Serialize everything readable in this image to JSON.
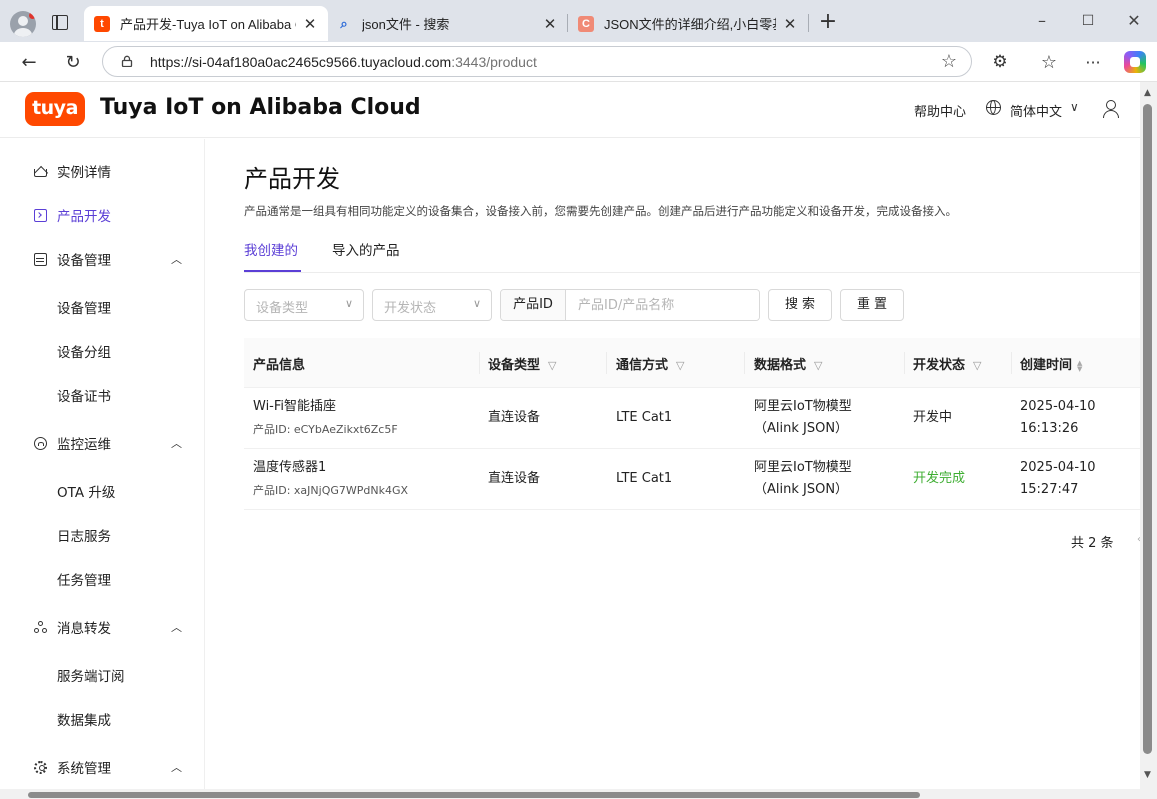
{
  "browser": {
    "tabs": [
      {
        "title": "产品开发-Tuya IoT on Alibaba Cloud",
        "favicon": "t",
        "favicon_color": "#ff4800",
        "active": true
      },
      {
        "title": "json文件 - 搜索",
        "favicon": "search-icon",
        "active": false
      },
      {
        "title": "JSON文件的详细介绍,小白零基础",
        "favicon": "C",
        "favicon_color": "#f08a76",
        "active": false
      }
    ],
    "url_main": "https://si-04af180a0ac2465c9566.tuyacloud.com",
    "url_rest": ":3443/product"
  },
  "app": {
    "logo_text": "tuya",
    "brand": "Tuya IoT on Alibaba Cloud",
    "help": "帮助中心",
    "language": "简体中文",
    "accent_color": "#5b3fd6"
  },
  "sidebar": {
    "items": [
      {
        "label": "实例详情",
        "icon": "home-icon"
      },
      {
        "label": "产品开发",
        "icon": "product-icon",
        "active": true
      },
      {
        "label": "设备管理",
        "icon": "device-icon",
        "expanded": true
      },
      {
        "label": "设备管理"
      },
      {
        "label": "设备分组"
      },
      {
        "label": "设备证书"
      },
      {
        "label": "监控运维",
        "icon": "monitor-icon",
        "expanded": true
      },
      {
        "label": "OTA 升级"
      },
      {
        "label": "日志服务"
      },
      {
        "label": "任务管理"
      },
      {
        "label": "消息转发",
        "icon": "message-icon",
        "expanded": true
      },
      {
        "label": "服务端订阅"
      },
      {
        "label": "数据集成"
      },
      {
        "label": "系统管理",
        "icon": "settings-icon",
        "expanded": true
      }
    ]
  },
  "page": {
    "title": "产品开发",
    "description": "产品通常是一组具有相同功能定义的设备集合，设备接入前，您需要先创建产品。创建产品后进行产品功能定义和设备开发，完成设备接入。",
    "tabs": [
      {
        "label": "我创建的",
        "active": true
      },
      {
        "label": "导入的产品"
      }
    ],
    "filters": {
      "device_type_placeholder": "设备类型",
      "dev_status_placeholder": "开发状态",
      "id_label": "产品ID",
      "search_placeholder": "产品ID/产品名称",
      "search_button": "搜索",
      "reset_button": "重置"
    },
    "table": {
      "columns": [
        "产品信息",
        "设备类型",
        "通信方式",
        "数据格式",
        "开发状态",
        "创建时间"
      ],
      "rows": [
        {
          "name": "Wi-Fi智能插座",
          "id": "产品ID: eCYbAeZikxt6Zc5F",
          "device_type": "直连设备",
          "comm": "LTE Cat1",
          "format_line1": "阿里云IoT物模型",
          "format_line2": "（Alink JSON）",
          "status": "开发中",
          "date": "2025-04-10",
          "time": "16:13:26"
        },
        {
          "name": "温度传感器1",
          "id": "产品ID: xaJNjQG7WPdNk4GX",
          "device_type": "直连设备",
          "comm": "LTE Cat1",
          "format_line1": "阿里云IoT物模型",
          "format_line2": "（Alink JSON）",
          "status": "开发完成",
          "status_color": "#3fae33",
          "date": "2025-04-10",
          "time": "15:27:47"
        }
      ],
      "total": "共 2 条"
    }
  }
}
